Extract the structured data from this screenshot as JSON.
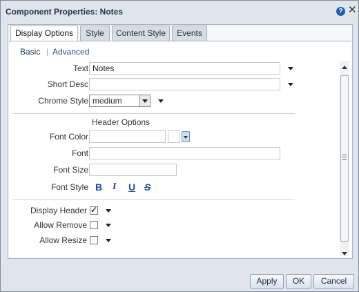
{
  "dialog": {
    "title": "Component Properties: Notes",
    "help_icon": "help-icon",
    "close_symbol": "✕"
  },
  "tabs": [
    {
      "label": "Display Options",
      "active": true
    },
    {
      "label": "Style",
      "active": false
    },
    {
      "label": "Content Style",
      "active": false
    },
    {
      "label": "Events",
      "active": false
    }
  ],
  "subnav": {
    "basic": "Basic",
    "separator": "|",
    "advanced": "Advanced"
  },
  "fields": {
    "text": {
      "label": "Text",
      "value": "Notes"
    },
    "short_desc": {
      "label": "Short Desc",
      "value": ""
    },
    "chrome_style": {
      "label": "Chrome Style",
      "value": "medium"
    }
  },
  "header_options": {
    "title": "Header Options",
    "font_color": {
      "label": "Font Color",
      "value": ""
    },
    "font": {
      "label": "Font",
      "value": ""
    },
    "font_size": {
      "label": "Font Size",
      "value": ""
    },
    "font_style": {
      "label": "Font Style",
      "bold": "B",
      "italic": "I",
      "underline": "U",
      "strike": "S"
    }
  },
  "options": {
    "display_header": {
      "label": "Display Header",
      "checked": true
    },
    "allow_remove": {
      "label": "Allow Remove",
      "checked": false
    },
    "allow_resize": {
      "label": "Allow Resize",
      "checked": false
    }
  },
  "footer": {
    "apply": "Apply",
    "ok": "OK",
    "cancel": "Cancel"
  },
  "colors": {
    "accent": "#1e4f92",
    "title": "#1f3246",
    "dialog_bg": "#dfe5eb"
  }
}
